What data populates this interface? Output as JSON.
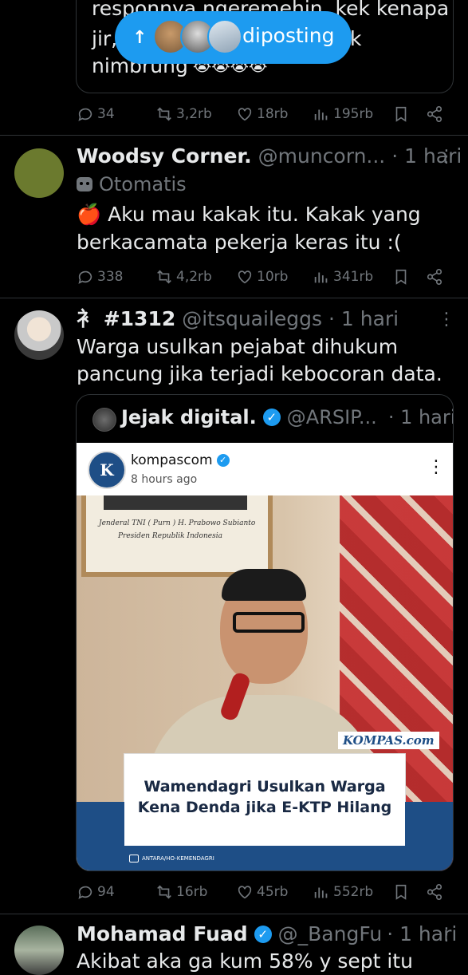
{
  "top_quote": {
    "line1": "responnya ngeremehin, kek kenapa",
    "line2a": "jir,",
    "line2b": "k",
    "line3": "nimbrung",
    "emoji": "😭😭😭😭"
  },
  "new_posts_pill": {
    "label": "diposting",
    "arrow": "↑"
  },
  "tweet1_actions": {
    "replies": "34",
    "reposts": "3,2rb",
    "likes": "18rb",
    "views": "195rb"
  },
  "tweet2": {
    "name": "Woodsy Corner.",
    "handle": "@muncorn...",
    "time": "· 1 hari",
    "automated_label": "Otomatis",
    "text_line1": "🍎 Aku mau kakak itu. Kakak yang",
    "text_line2": "berkacamata pekerja keras itu :(",
    "replies": "338",
    "reposts": "4,2rb",
    "likes": "10rb",
    "views": "341rb",
    "avatar_color": "#6b7a2e"
  },
  "tweet3": {
    "name": "⻂ #1312",
    "handle": "@itsquaileggs",
    "time": "· 1 hari",
    "text_line1": "Warga usulkan pejabat dihukum",
    "text_line2": "pancung jika terjadi kebocoran data.",
    "replies": "94",
    "reposts": "16rb",
    "likes": "45rb",
    "views": "552rb"
  },
  "quoted": {
    "name": "Jejak digital.",
    "handle": "@ARSIP...",
    "time": "· 1 hari",
    "ig_account": "kompascom",
    "ig_time": "8 hours ago",
    "frame_line1": "Jenderal TNI ( Purn ) H. Prabowo Subianto",
    "frame_line2": "Presiden Republik Indonesia",
    "brand": "KOMPAS.com",
    "headline_line1": "Wamendagri Usulkan Warga",
    "headline_line2": "Kena Denda jika E-KTP Hilang",
    "credit": "ANTARA/HO-KEMENDAGRI",
    "brand_color": "#1e4e86"
  },
  "tweet4": {
    "name": "Mohamad Fuad",
    "handle": "@_BangFu",
    "time": "· 1 hari",
    "text_peek": "Akibat aka ga kum 58% y sept itu"
  }
}
